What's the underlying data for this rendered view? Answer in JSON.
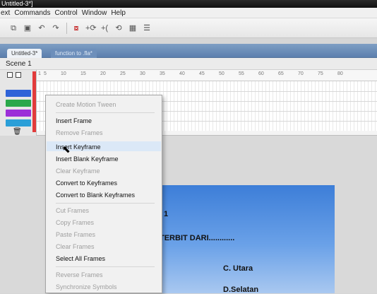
{
  "window": {
    "title": "Untitled-3*]"
  },
  "menu": {
    "items": [
      "ext",
      "Commands",
      "Control",
      "Window",
      "Help"
    ]
  },
  "toolbar": {
    "icons": [
      "copy-icon",
      "paste-icon",
      "undo-icon",
      "redo-icon",
      "snap-icon",
      "smooth-icon",
      "straighten-icon",
      "rotate-icon",
      "scale-icon",
      "align-icon"
    ]
  },
  "tabs": {
    "active": "Untitled-3*",
    "inactive": "function to .fla*"
  },
  "scene": {
    "label": "Scene 1"
  },
  "timeline": {
    "ruler": [
      "1",
      "5",
      "10",
      "15",
      "20",
      "25",
      "30",
      "35",
      "40",
      "45",
      "50",
      "55",
      "60",
      "65",
      "70",
      "75",
      "80"
    ],
    "layer_colors": [
      "#2f63d8",
      "#2aa84a",
      "#9c2fd8",
      "#2b9fd8"
    ]
  },
  "context_menu": {
    "items": [
      {
        "label": "Create Motion Tween",
        "enabled": false
      },
      {
        "label": "Insert Frame",
        "enabled": true
      },
      {
        "label": "Remove Frames",
        "enabled": false
      },
      {
        "label": "Insert Keyframe",
        "enabled": true
      },
      {
        "label": "Insert Blank Keyframe",
        "enabled": true
      },
      {
        "label": "Clear Keyframe",
        "enabled": false
      },
      {
        "label": "Convert to Keyframes",
        "enabled": true
      },
      {
        "label": "Convert to Blank Keyframes",
        "enabled": true
      },
      {
        "label": "Cut Frames",
        "enabled": false
      },
      {
        "label": "Copy Frames",
        "enabled": false
      },
      {
        "label": "Paste Frames",
        "enabled": false
      },
      {
        "label": "Clear Frames",
        "enabled": false
      },
      {
        "label": "Select All Frames",
        "enabled": true
      },
      {
        "label": "Reverse Frames",
        "enabled": false
      },
      {
        "label": "Synchronize Symbols",
        "enabled": false
      }
    ]
  },
  "stage": {
    "lines": [
      "1",
      "TERBIT DARI............",
      "C. Utara",
      "D.Selatan"
    ]
  }
}
